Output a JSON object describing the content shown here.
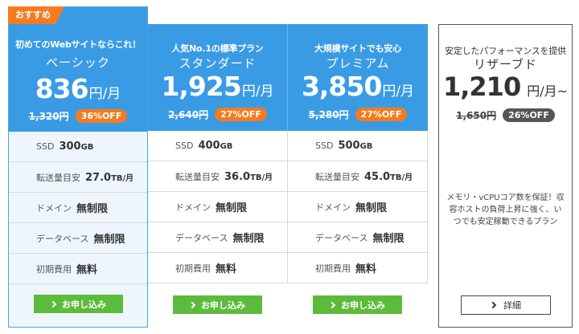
{
  "plans": [
    {
      "badge": "おすすめ",
      "tagline": "初めてのWebサイトならこれ！",
      "name": "ベーシック",
      "price": "836",
      "unit": "円/月",
      "old_price": "1,320円",
      "discount": "36%OFF",
      "specs": [
        {
          "label": "SSD",
          "value": "300",
          "suffix": "GB"
        },
        {
          "label": "転送量目安",
          "value": "27.0",
          "suffix": "TB/月"
        },
        {
          "label": "ドメイン",
          "value": "無制限",
          "suffix": ""
        },
        {
          "label": "データベース",
          "value": "無制限",
          "suffix": ""
        },
        {
          "label": "初期費用",
          "value": "無料",
          "suffix": ""
        }
      ],
      "button": "お申し込み"
    },
    {
      "tagline": "人気No.1の標準プラン",
      "name": "スタンダード",
      "price": "1,925",
      "unit": "円/月",
      "old_price": "2,640円",
      "discount": "27%OFF",
      "specs": [
        {
          "label": "SSD",
          "value": "400",
          "suffix": "GB"
        },
        {
          "label": "転送量目安",
          "value": "36.0",
          "suffix": "TB/月"
        },
        {
          "label": "ドメイン",
          "value": "無制限",
          "suffix": ""
        },
        {
          "label": "データベース",
          "value": "無制限",
          "suffix": ""
        },
        {
          "label": "初期費用",
          "value": "無料",
          "suffix": ""
        }
      ],
      "button": "お申し込み"
    },
    {
      "tagline": "大規模サイトでも安心",
      "name": "プレミアム",
      "price": "3,850",
      "unit": "円/月",
      "old_price": "5,280円",
      "discount": "27%OFF",
      "specs": [
        {
          "label": "SSD",
          "value": "500",
          "suffix": "GB"
        },
        {
          "label": "転送量目安",
          "value": "45.0",
          "suffix": "TB/月"
        },
        {
          "label": "ドメイン",
          "value": "無制限",
          "suffix": ""
        },
        {
          "label": "データベース",
          "value": "無制限",
          "suffix": ""
        },
        {
          "label": "初期費用",
          "value": "無料",
          "suffix": ""
        }
      ],
      "button": "お申し込み"
    },
    {
      "tagline": "安定したパフォーマンスを提供",
      "name": "リザーブド",
      "price": "1,210",
      "unit": "円/月~",
      "old_price": "1,650円",
      "discount": "26%OFF",
      "description": "メモリ・vCPUコア数を保証！収容ホストの負荷上昇に強く、いつでも安定稼動できるプラン",
      "button": "詳細"
    }
  ],
  "colors": {
    "header_blue": "#3a9be5",
    "discount_orange": "#f47b1f",
    "apply_green": "#5dbb3c",
    "reserved_badge": "#555555"
  },
  "icons": {
    "button_arrow": "chevron-right-icon"
  }
}
